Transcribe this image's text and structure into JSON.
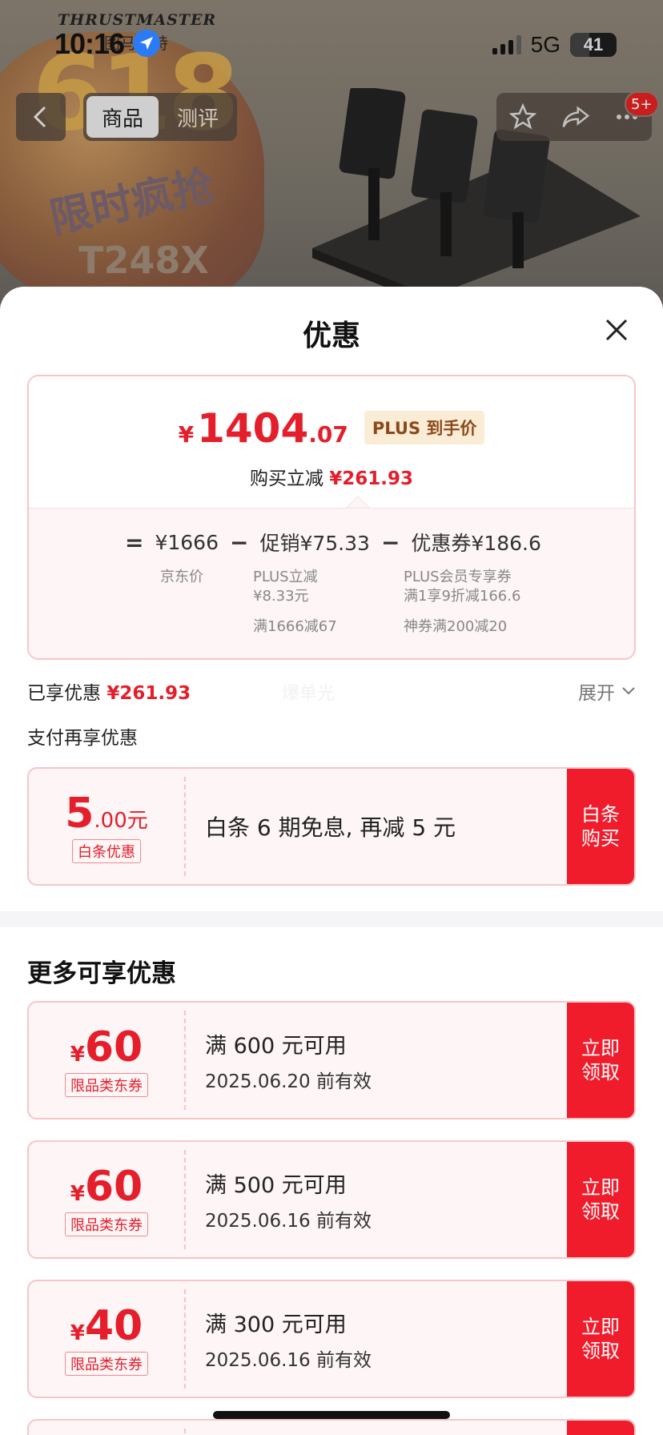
{
  "statusbar": {
    "time": "10:16",
    "network": "5G",
    "battery": "41",
    "battery_level": 0.41
  },
  "product_bg": {
    "brand": "THRUSTMASTER",
    "brand_sub": "图马思特",
    "promo_number": "618",
    "promo_text": "限时疯抢",
    "model": "T248X"
  },
  "nav": {
    "tabs": [
      {
        "label": "商品",
        "active": true
      },
      {
        "label": "测评",
        "active": false
      }
    ],
    "message_badge": "5+"
  },
  "sheet": {
    "title": "优惠",
    "price": {
      "currency": "¥",
      "integer": "1404",
      "decimal": ".07",
      "plus_tag": "PLUS 到手价",
      "sub_label": "购买立减",
      "sub_amount": "¥261.93"
    },
    "breakdown": {
      "eq": "=",
      "jd_price": "¥1666",
      "jd_price_label": "京东价",
      "minus": "−",
      "promo": "促销¥75.33",
      "promo_line1": "PLUS立减",
      "promo_line2": "¥8.33元",
      "promo_line3": "满1666减67",
      "coupon": "优惠券¥186.6",
      "coupon_line1": "PLUS会员专享券",
      "coupon_line2": "满1享9折减166.6",
      "coupon_line3": "神券满200减20"
    },
    "enjoyed_label": "已享优惠",
    "enjoyed_amount": "¥261.93",
    "ghost_text": "爆单光",
    "expand_label": "展开",
    "pay_more_label": "支付再享优惠",
    "baitiao": {
      "amount_int": "5",
      "amount_dec": ".00元",
      "tag": "白条优惠",
      "desc": "白条 6 期免息, 再减 5 元",
      "btn_line1": "白条",
      "btn_line2": "购买"
    },
    "more_title": "更多可享优惠",
    "coupons": [
      {
        "currency": "¥",
        "amount": "60",
        "tag": "限品类东券",
        "cond": "满 600 元可用",
        "date": "2025.06.20 前有效",
        "btn_line1": "立即",
        "btn_line2": "领取"
      },
      {
        "currency": "¥",
        "amount": "60",
        "tag": "限品类东券",
        "cond": "满 500 元可用",
        "date": "2025.06.16 前有效",
        "btn_line1": "立即",
        "btn_line2": "领取"
      },
      {
        "currency": "¥",
        "amount": "40",
        "tag": "限品类东券",
        "cond": "满 300 元可用",
        "date": "2025.06.16 前有效",
        "btn_line1": "立即",
        "btn_line2": "领取"
      }
    ]
  },
  "colors": {
    "accent_red": "#e41e2b",
    "button_red": "#f01c2c",
    "card_border": "#f7c5c8",
    "card_bg": "#fdf5f6"
  }
}
